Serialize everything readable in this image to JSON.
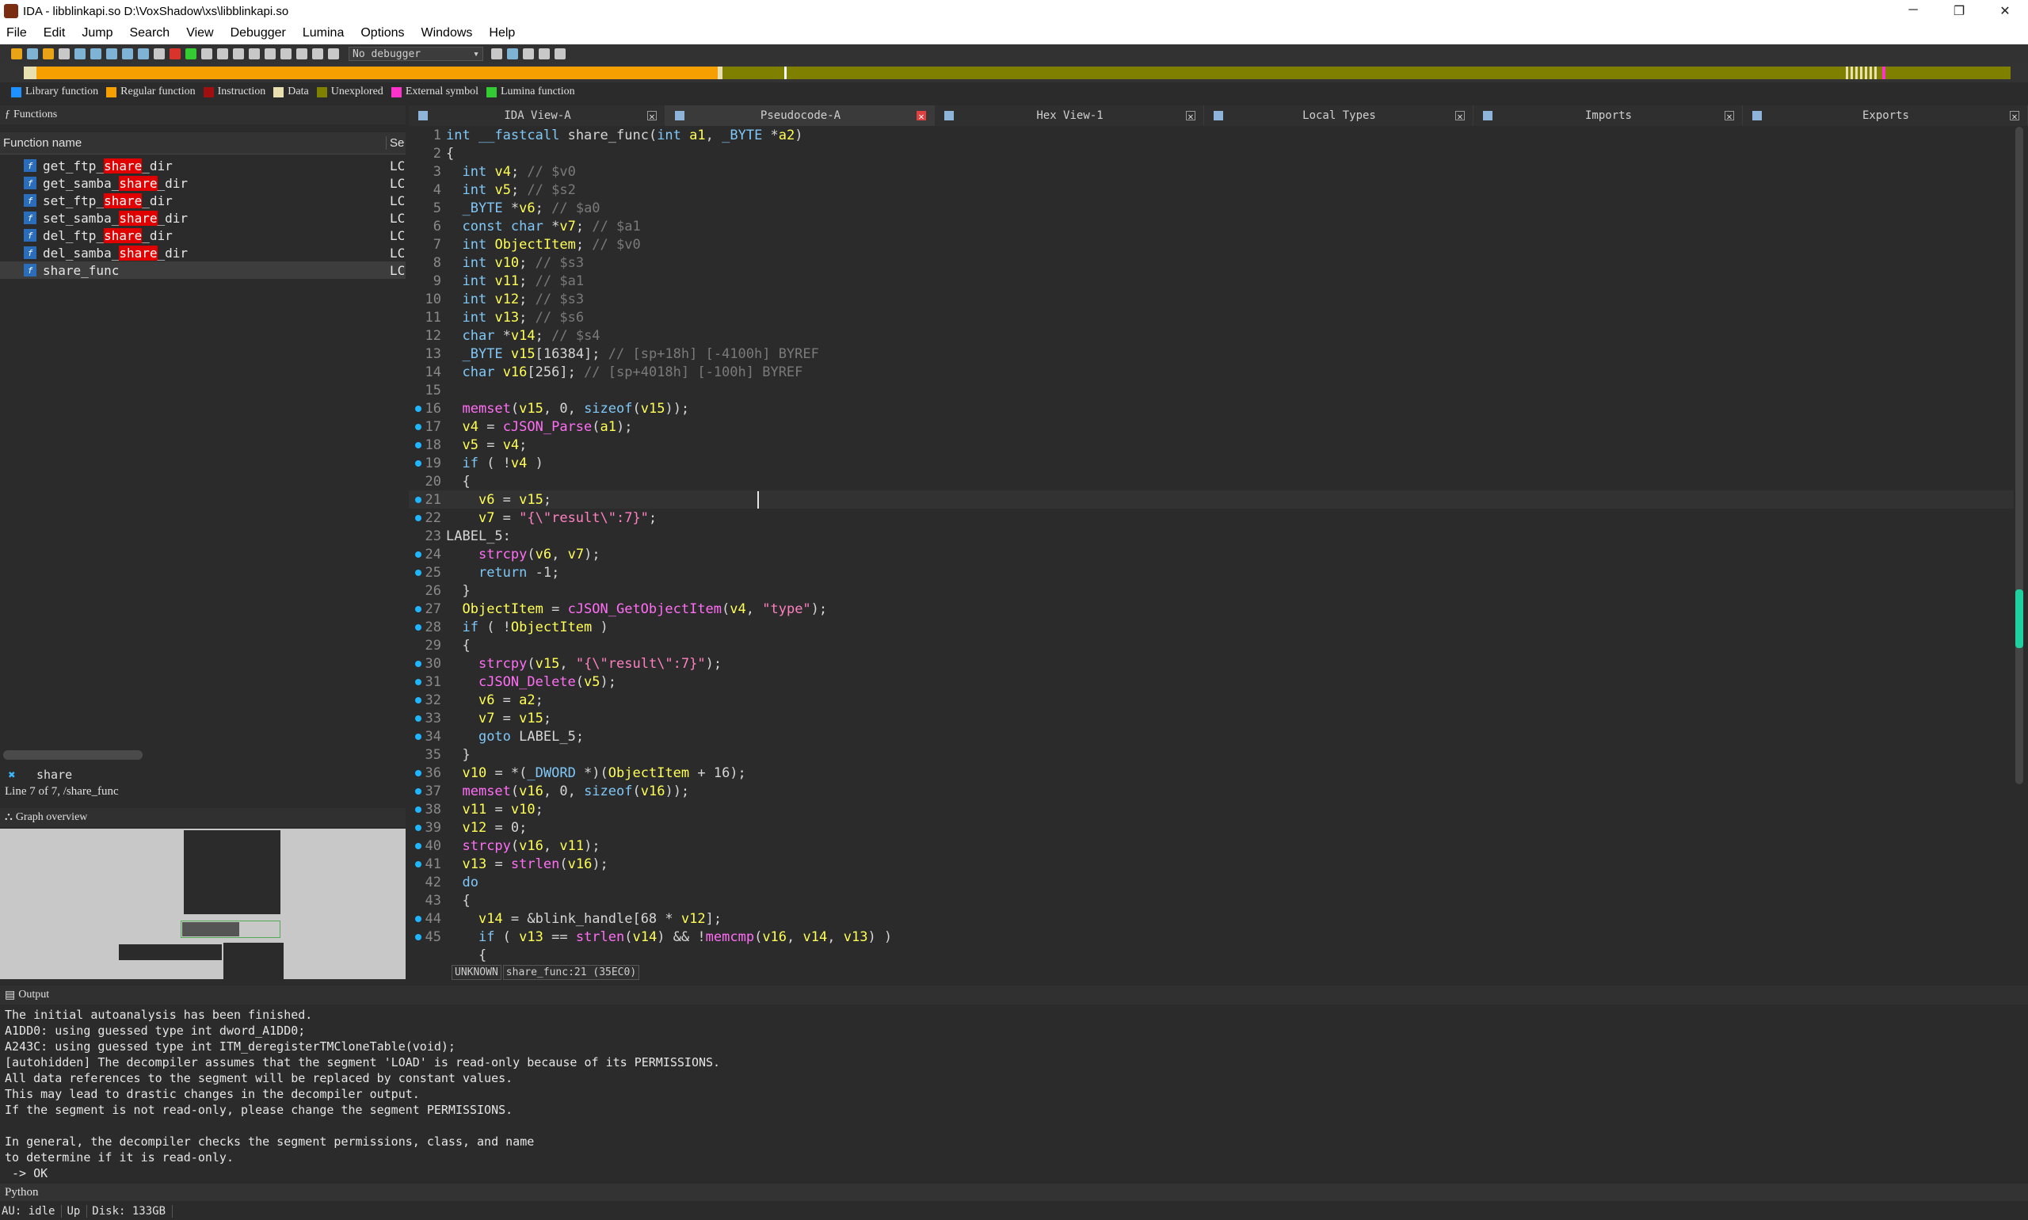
{
  "window": {
    "title": "IDA - libblinkapi.so D:\\VoxShadow\\xs\\libblinkapi.so",
    "minimize": "─",
    "maximize": "❐",
    "close": "✕"
  },
  "menu": [
    "File",
    "Edit",
    "Jump",
    "Search",
    "View",
    "Debugger",
    "Lumina",
    "Options",
    "Windows",
    "Help"
  ],
  "toolbar": {
    "debugger": "No debugger"
  },
  "legend": [
    {
      "label": "Library function",
      "color": "#1e90ff"
    },
    {
      "label": "Regular function",
      "color": "#f5a000"
    },
    {
      "label": "Instruction",
      "color": "#a01010"
    },
    {
      "label": "Data",
      "color": "#e8e0b0"
    },
    {
      "label": "Unexplored",
      "color": "#808000"
    },
    {
      "label": "External symbol",
      "color": "#ff33cc"
    },
    {
      "label": "Lumina function",
      "color": "#33cc33"
    }
  ],
  "functions_panel": {
    "title": "Functions",
    "col_name": "Function name",
    "col_seg": "Se",
    "rows": [
      {
        "pre": "get_ftp_",
        "hl": "share",
        "post": "_dir",
        "seg": "LC"
      },
      {
        "pre": "get_samba_",
        "hl": "share",
        "post": "_dir",
        "seg": "LC"
      },
      {
        "pre": "set_ftp_",
        "hl": "share",
        "post": "_dir",
        "seg": "LC"
      },
      {
        "pre": "set_samba_",
        "hl": "share",
        "post": "_dir",
        "seg": "LC"
      },
      {
        "pre": "del_ftp_",
        "hl": "share",
        "post": "_dir",
        "seg": "LC"
      },
      {
        "pre": "del_samba_",
        "hl": "share",
        "post": "_dir",
        "seg": "LC"
      },
      {
        "pre": "",
        "hl": "",
        "post": "share_func",
        "seg": "LC"
      }
    ],
    "filter": "share",
    "line_info": "Line 7 of 7, /share_func"
  },
  "graph_overview": {
    "title": "Graph overview"
  },
  "tabs": [
    {
      "label": "IDA View-A",
      "active": false
    },
    {
      "label": "Pseudocode-A",
      "active": true
    },
    {
      "label": "Hex View-1",
      "active": false
    },
    {
      "label": "Local Types",
      "active": false
    },
    {
      "label": "Imports",
      "active": false
    },
    {
      "label": "Exports",
      "active": false
    }
  ],
  "code_lines": [
    {
      "n": "1",
      "dot": false,
      "t": "int __fastcall share_func(int a1, _BYTE *a2)"
    },
    {
      "n": "2",
      "dot": false,
      "t": "{"
    },
    {
      "n": "3",
      "dot": false,
      "t": "  int v4; // $v0"
    },
    {
      "n": "4",
      "dot": false,
      "t": "  int v5; // $s2"
    },
    {
      "n": "5",
      "dot": false,
      "t": "  _BYTE *v6; // $a0"
    },
    {
      "n": "6",
      "dot": false,
      "t": "  const char *v7; // $a1"
    },
    {
      "n": "7",
      "dot": false,
      "t": "  int ObjectItem; // $v0"
    },
    {
      "n": "8",
      "dot": false,
      "t": "  int v10; // $s3"
    },
    {
      "n": "9",
      "dot": false,
      "t": "  int v11; // $a1"
    },
    {
      "n": "10",
      "dot": false,
      "t": "  int v12; // $s3"
    },
    {
      "n": "11",
      "dot": false,
      "t": "  int v13; // $s6"
    },
    {
      "n": "12",
      "dot": false,
      "t": "  char *v14; // $s4"
    },
    {
      "n": "13",
      "dot": false,
      "t": "  _BYTE v15[16384]; // [sp+18h] [-4100h] BYREF"
    },
    {
      "n": "14",
      "dot": false,
      "t": "  char v16[256]; // [sp+4018h] [-100h] BYREF"
    },
    {
      "n": "15",
      "dot": false,
      "t": ""
    },
    {
      "n": "16",
      "dot": true,
      "t": "  memset(v15, 0, sizeof(v15));"
    },
    {
      "n": "17",
      "dot": true,
      "t": "  v4 = cJSON_Parse(a1);"
    },
    {
      "n": "18",
      "dot": true,
      "t": "  v5 = v4;"
    },
    {
      "n": "19",
      "dot": true,
      "t": "  if ( !v4 )"
    },
    {
      "n": "20",
      "dot": false,
      "t": "  {"
    },
    {
      "n": "21",
      "dot": true,
      "t": "    v6 = v15;"
    },
    {
      "n": "22",
      "dot": true,
      "t": "    v7 = \"{\\\"result\\\":7}\";"
    },
    {
      "n": "23",
      "dot": false,
      "t": "LABEL_5:"
    },
    {
      "n": "24",
      "dot": true,
      "t": "    strcpy(v6, v7);"
    },
    {
      "n": "25",
      "dot": true,
      "t": "    return -1;"
    },
    {
      "n": "26",
      "dot": false,
      "t": "  }"
    },
    {
      "n": "27",
      "dot": true,
      "t": "  ObjectItem = cJSON_GetObjectItem(v4, \"type\");"
    },
    {
      "n": "28",
      "dot": true,
      "t": "  if ( !ObjectItem )"
    },
    {
      "n": "29",
      "dot": false,
      "t": "  {"
    },
    {
      "n": "30",
      "dot": true,
      "t": "    strcpy(v15, \"{\\\"result\\\":7}\");"
    },
    {
      "n": "31",
      "dot": true,
      "t": "    cJSON_Delete(v5);"
    },
    {
      "n": "32",
      "dot": true,
      "t": "    v6 = a2;"
    },
    {
      "n": "33",
      "dot": true,
      "t": "    v7 = v15;"
    },
    {
      "n": "34",
      "dot": true,
      "t": "    goto LABEL_5;"
    },
    {
      "n": "35",
      "dot": false,
      "t": "  }"
    },
    {
      "n": "36",
      "dot": true,
      "t": "  v10 = *(_DWORD *)(ObjectItem + 16);"
    },
    {
      "n": "37",
      "dot": true,
      "t": "  memset(v16, 0, sizeof(v16));"
    },
    {
      "n": "38",
      "dot": true,
      "t": "  v11 = v10;"
    },
    {
      "n": "39",
      "dot": true,
      "t": "  v12 = 0;"
    },
    {
      "n": "40",
      "dot": true,
      "t": "  strcpy(v16, v11);"
    },
    {
      "n": "41",
      "dot": true,
      "t": "  v13 = strlen(v16);"
    },
    {
      "n": "42",
      "dot": false,
      "t": "  do"
    },
    {
      "n": "43",
      "dot": false,
      "t": "  {"
    },
    {
      "n": "44",
      "dot": true,
      "t": "    v14 = &blink_handle[68 * v12];"
    },
    {
      "n": "45",
      "dot": true,
      "t": "    if ( v13 == strlen(v14) && !memcmp(v16, v14, v13) )"
    },
    {
      "n": "",
      "dot": false,
      "t": "    {"
    }
  ],
  "code_status": [
    "UNKNOWN",
    "share_func:21 (35EC0)"
  ],
  "output": {
    "title": "Output",
    "text": "The initial autoanalysis has been finished.\nA1DD0: using guessed type int dword_A1DD0;\nA243C: using guessed type int ITM_deregisterTMCloneTable(void);\n[autohidden] The decompiler assumes that the segment 'LOAD' is read-only because of its PERMISSIONS.\nAll data references to the segment will be replaced by constant values.\nThis may lead to drastic changes in the decompiler output.\nIf the segment is not read-only, please change the segment PERMISSIONS.\n\nIn general, the decompiler checks the segment permissions, class, and name\nto determine if it is read-only.\n -> OK"
  },
  "python_label": "Python",
  "status": [
    "AU:  idle",
    "Up",
    "Disk: 133GB"
  ]
}
